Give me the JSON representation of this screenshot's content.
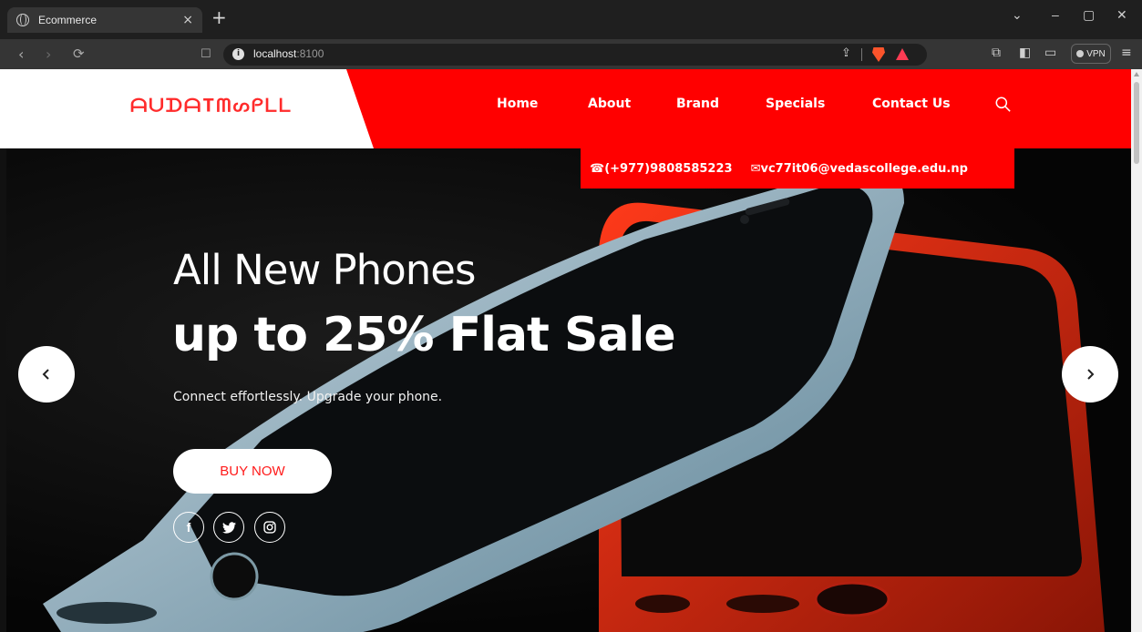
{
  "browser": {
    "tab_title": "Ecommerce",
    "tab_close": "×",
    "new_tab": "+",
    "url_host": "localhost",
    "url_port": ":8100",
    "vpn_label": "VPN",
    "window_controls": [
      "⌄",
      "–",
      "▢",
      "✕"
    ]
  },
  "header": {
    "logo_text": "ᗩᑌᗪᗩTᗰᔕᑭᒪᒪ",
    "menu": [
      "Home",
      "About",
      "Brand",
      "Specials",
      "Contact Us"
    ],
    "accent_color": "#ff0000"
  },
  "contact": {
    "phone": "(+977)9808585223",
    "email": "vc77it06@vedascollege.edu.np"
  },
  "hero": {
    "headline": "All New Phones",
    "subheadline": "up to 25% Flat Sale",
    "tagline": "Connect effortlessly. Upgrade your phone.",
    "cta": "BUY NOW",
    "social": [
      "facebook",
      "twitter",
      "instagram"
    ]
  },
  "icons": {
    "prev": "chevron-left-icon",
    "next": "chevron-right-icon",
    "search": "search-icon"
  }
}
